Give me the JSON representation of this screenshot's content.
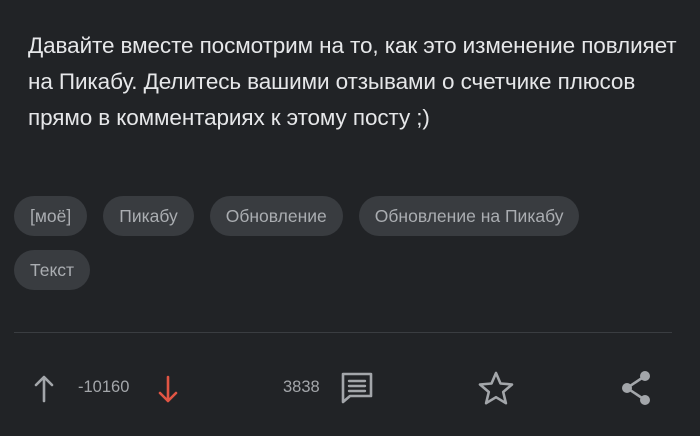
{
  "post": {
    "text": "Давайте вместе посмотрим на то, как это изменение повлияет на Пикабу. Делитесь вашими отзывами о счетчике плюсов прямо в комментариях к этому посту ;)"
  },
  "tags": [
    {
      "label": "[моё]"
    },
    {
      "label": "Пикабу"
    },
    {
      "label": "Обновление"
    },
    {
      "label": "Обновление на Пикабу"
    },
    {
      "label": "Текст"
    }
  ],
  "actions": {
    "rating": "-10160",
    "comments_count": "3838"
  },
  "icons": {
    "upvote": "arrow-up-icon",
    "downvote": "arrow-down-icon",
    "comments": "comment-icon",
    "save": "star-icon",
    "share": "share-icon"
  },
  "colors": {
    "background": "#212326",
    "text": "#e6e7e9",
    "tag_background": "#393c40",
    "tag_text": "#aaadb1",
    "muted": "#a3a6aa",
    "downvote": "#e05544"
  }
}
